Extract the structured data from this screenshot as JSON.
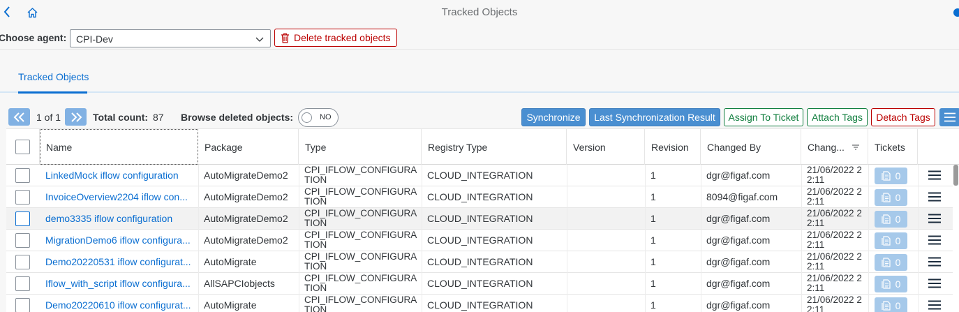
{
  "header": {
    "title": "Tracked Objects",
    "back_icon": "chevron-left-icon",
    "home_icon": "home-icon"
  },
  "agent": {
    "label": "Choose agent:",
    "value": "CPI-Dev",
    "delete_label": "Delete tracked objects"
  },
  "tabs": [
    {
      "label": "Tracked Objects"
    }
  ],
  "toolbar": {
    "page_info": "1 of 1",
    "total_count_label": "Total count:",
    "total_count": "87",
    "browse_deleted_label": "Browse deleted objects:",
    "browse_deleted_value": "NO",
    "synchronize": "Synchronize",
    "last_sync": "Last Synchronization Result",
    "assign_ticket": "Assign To Ticket",
    "attach_tags": "Attach Tags",
    "detach_tags": "Detach Tags"
  },
  "table": {
    "columns": [
      "Name",
      "Package",
      "Type",
      "Registry Type",
      "Version",
      "Revision",
      "Changed By",
      "Chang...",
      "Tickets"
    ],
    "rows": [
      {
        "name": "LinkedMock iflow configuration",
        "package": "AutoMigrateDemo2",
        "type": "CPI_IFLOW_CONFIGURATION",
        "registry": "CLOUD_INTEGRATION",
        "version": "",
        "revision": "1",
        "changed_by": "dgr@figaf.com",
        "changed": "21/06/2022 22:11",
        "tickets": "0"
      },
      {
        "name": "InvoiceOverview2204 iflow con...",
        "package": "AutoMigrateDemo2",
        "type": "CPI_IFLOW_CONFIGURATION",
        "registry": "CLOUD_INTEGRATION",
        "version": "",
        "revision": "1",
        "changed_by": "8094@figaf.com",
        "changed": "21/06/2022 22:11",
        "tickets": "0"
      },
      {
        "name": "demo3335 iflow configuration",
        "package": "AutoMigrateDemo2",
        "type": "CPI_IFLOW_CONFIGURATION",
        "registry": "CLOUD_INTEGRATION",
        "version": "",
        "revision": "1",
        "changed_by": "dgr@figaf.com",
        "changed": "21/06/2022 22:11",
        "tickets": "0"
      },
      {
        "name": "MigrationDemo6 iflow configura...",
        "package": "AutoMigrateDemo2",
        "type": "CPI_IFLOW_CONFIGURATION",
        "registry": "CLOUD_INTEGRATION",
        "version": "",
        "revision": "1",
        "changed_by": "dgr@figaf.com",
        "changed": "21/06/2022 22:11",
        "tickets": "0"
      },
      {
        "name": "Demo20220531 iflow configurat...",
        "package": "AutoMigrate",
        "type": "CPI_IFLOW_CONFIGURATION",
        "registry": "CLOUD_INTEGRATION",
        "version": "",
        "revision": "1",
        "changed_by": "dgr@figaf.com",
        "changed": "21/06/2022 22:11",
        "tickets": "0"
      },
      {
        "name": "Iflow_with_script iflow configura...",
        "package": "AllSAPCIobjects",
        "type": "CPI_IFLOW_CONFIGURATION",
        "registry": "CLOUD_INTEGRATION",
        "version": "",
        "revision": "1",
        "changed_by": "dgr@figaf.com",
        "changed": "21/06/2022 22:11",
        "tickets": "0"
      },
      {
        "name": "Demo20220610 iflow configurat...",
        "package": "AutoMigrate",
        "type": "CPI_IFLOW_CONFIGURATION",
        "registry": "CLOUD_INTEGRATION",
        "version": "",
        "revision": "1",
        "changed_by": "dgr@figaf.com",
        "changed": "21/06/2022 22:11",
        "tickets": "0"
      }
    ]
  },
  "colors": {
    "accent": "#0a6ed1",
    "danger": "#bb0000",
    "success": "#107e3e",
    "primary_button": "#4a8fd1",
    "ticket_button": "#a6c9ea"
  }
}
